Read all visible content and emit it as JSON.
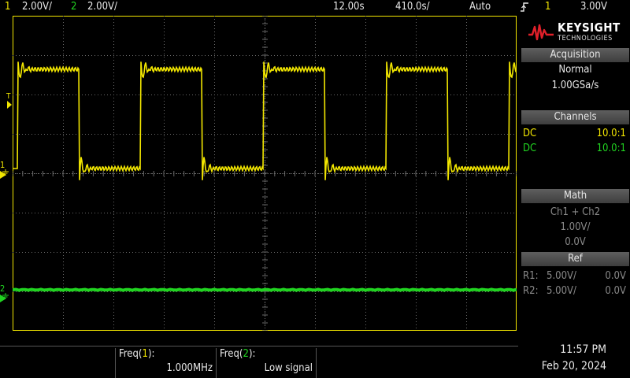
{
  "topbar": {
    "ch1_num": "1",
    "ch1_scale": "2.00V/",
    "ch2_num": "2",
    "ch2_scale": "2.00V/",
    "delay": "12.00s",
    "timebase": "410.0s/",
    "trigger_mode": "Auto",
    "trigger_icon": "rising-edge-icon",
    "trigger_source": "1",
    "trigger_level": "3.00V"
  },
  "markers": {
    "trigger": "T",
    "ch1": "1",
    "ch2": "2"
  },
  "logo": {
    "brand": "KEYSIGHT",
    "sub": "TECHNOLOGIES"
  },
  "acquisition": {
    "header": "Acquisition",
    "mode": "Normal",
    "rate": "1.00GSa/s"
  },
  "channels": {
    "header": "Channels",
    "rows": [
      {
        "coupling": "DC",
        "probe": "10.0:1"
      },
      {
        "coupling": "DC",
        "probe": "10.0:1"
      }
    ]
  },
  "math": {
    "header": "Math",
    "function": "Ch1 + Ch2",
    "scale": "1.00V/",
    "offset": "0.0V"
  },
  "ref": {
    "header": "Ref",
    "rows": [
      {
        "name": "R1:",
        "scale": "5.00V/",
        "offset": "0.0V"
      },
      {
        "name": "R2:",
        "scale": "5.00V/",
        "offset": "0.0V"
      }
    ]
  },
  "measurements": [
    {
      "label_pre": "Freq(",
      "label_ch": "1",
      "label_post": "):",
      "value": "1.000MHz"
    },
    {
      "label_pre": "Freq(",
      "label_ch": "2",
      "label_post": "):",
      "value": "Low signal"
    }
  ],
  "clock": {
    "time": "11:57 PM",
    "date": "Feb 20, 2024"
  },
  "colors": {
    "ch1": "#f2e600",
    "ch2": "#21d421",
    "grid": "#6a6a6a",
    "frame": "#f2e600"
  }
}
